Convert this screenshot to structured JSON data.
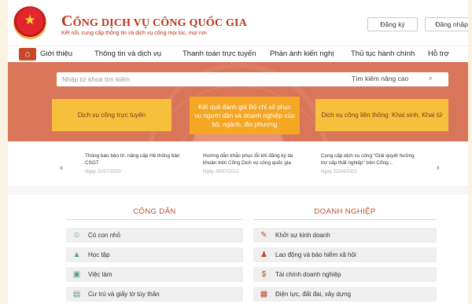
{
  "header": {
    "title_initial": "C",
    "title_rest": "ỔNG DỊCH VỤ CÔNG QUỐC GIA",
    "subtitle": "Kết nối, cung cấp thông tin và dịch vụ công mọi lúc, mọi nơi",
    "register": "Đăng ký",
    "login": "Đăng nhập"
  },
  "nav": {
    "items": [
      "Giới thiệu",
      "Thông tin và dịch vụ",
      "Thanh toán trực tuyến",
      "Phản ánh kiến nghị",
      "Thủ tục hành chính",
      "Hỗ trợ"
    ]
  },
  "search": {
    "placeholder": "Nhập từ khoá tìm kiếm",
    "advanced": "Tìm kiếm nâng cao"
  },
  "tiles": [
    "Dịch vụ công trực tuyến",
    "Kết quả đánh giá Bộ chỉ số phục vụ người dân và doanh nghiệp của bộ, ngành, địa phương",
    "Dịch vụ công liên thông: Khai sinh, Khai tử"
  ],
  "news": [
    {
      "title": "Thông báo bảo trì, nâng cấp Hệ thống bản CSGT",
      "date": "Ngày 21/07/2023"
    },
    {
      "title": "Hướng dẫn khắc phục lỗi khi đăng ký tài khoản trên Cổng Dịch vụ công quốc gia",
      "date": "Ngày 29/07/2022"
    },
    {
      "title": "Cung cấp dịch vụ công \"Giải quyết hưởng trợ cấp thất nghiệp\" trên Cổng...",
      "date": "Ngày 22/04/2022"
    }
  ],
  "citizen": {
    "title": "CÔNG DÂN",
    "items": [
      "Có con nhỏ",
      "Học tập",
      "Việc làm",
      "Cư trú và giấy tờ tùy thân"
    ]
  },
  "business": {
    "title": "DOANH NGHIỆP",
    "items": [
      "Khởi sự kinh doanh",
      "Lao động và bảo hiểm xã hội",
      "Tài chính doanh nghiệp",
      "Điện lực, đất đai, xây dựng"
    ]
  },
  "colors": {
    "accent": "#c0492b",
    "hero": "#d9765a",
    "tile": "#f7c03c",
    "tile_highlight": "#f5a623"
  }
}
